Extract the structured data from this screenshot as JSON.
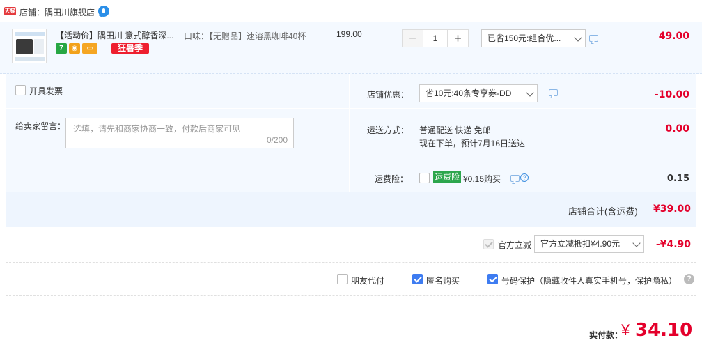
{
  "shop": {
    "badge": "天猫",
    "label": "店铺：隅田川旗舰店"
  },
  "item": {
    "title": "【活动价】隅田川 意式醇香深...",
    "promo_tag": "狂暑季",
    "svc_icons": [
      "seven-day-return-icon",
      "guarantee-icon",
      "credit-card-icon"
    ],
    "svc_7_text": "7",
    "sku": "口味：【无赠品】速溶黑咖啡40杯",
    "unit_price": "199.00",
    "quantity": "1",
    "qty_minus": "−",
    "qty_plus": "+",
    "discount_select": "已省150元:组合优...",
    "subtotal": "49.00"
  },
  "invoice": {
    "label": "开具发票"
  },
  "memo": {
    "label": "给卖家留言：",
    "placeholder": "选填，请先和商家协商一致，付款后商家可见",
    "count": "0/200"
  },
  "shop_discount": {
    "label": "店铺优惠：",
    "select": "省10元:40条专享券-DD",
    "amount": "-10.00"
  },
  "shipping": {
    "label": "运送方式：",
    "line1": "普通配送 快递 免邮",
    "line2": "现在下单，预计7月16日送达",
    "amount": "0.00"
  },
  "insurance": {
    "label": "运费险：",
    "tag": "运费险",
    "text": "¥0.15购买",
    "amount": "0.15"
  },
  "shop_total": {
    "label": "店铺合计(含运费)",
    "amount": "¥39.00"
  },
  "official": {
    "label": "官方立减",
    "select": "官方立减抵扣¥4.90元",
    "amount": "-¥4.90"
  },
  "options": {
    "friend_pay": "朋友代付",
    "anonymous": "匿名购买",
    "number_protect": "号码保护（隐藏收件人真实手机号，保护隐私）"
  },
  "pay": {
    "label": "实付款：",
    "currency": "¥",
    "amount": "34.10"
  },
  "colors": {
    "accent_red": "#e4002b",
    "checkbox_blue": "#3e7cf1",
    "panel_bg": "#f4f9ff",
    "insurance_green": "#2ca64d"
  }
}
